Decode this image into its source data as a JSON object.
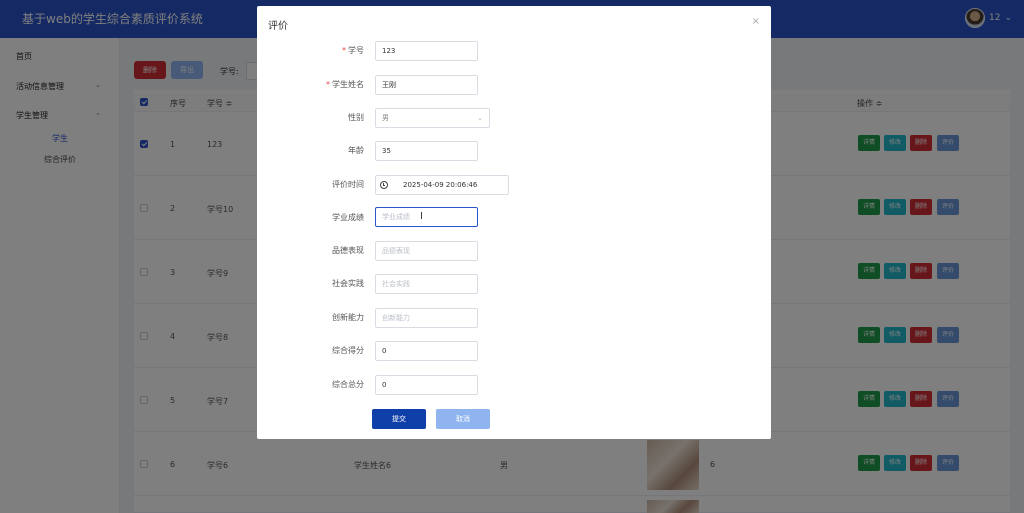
{
  "app": {
    "title": "基于web的学生综合素质评价系统"
  },
  "user": {
    "name": "12",
    "chevron": "⌄"
  },
  "sidebar": {
    "home": "首页",
    "activity": "活动信息管理",
    "student_mgmt": "学生管理",
    "student": "学生",
    "evaluation": "综合评价",
    "arrow_down": "⌄",
    "arrow_up": "⌃"
  },
  "toolbar": {
    "delete_label": "删除",
    "export_label": "导出",
    "student_no_label": "学号:"
  },
  "table": {
    "headers": {
      "index": "序号",
      "student_no": "学号 ≑",
      "actions": "操作 ≑"
    },
    "rows": [
      {
        "index": "1",
        "student_no": "123",
        "name": "",
        "gender": "",
        "extra": "",
        "checked": true
      },
      {
        "index": "2",
        "student_no": "学号10",
        "name": "",
        "gender": "",
        "extra": "",
        "checked": false
      },
      {
        "index": "3",
        "student_no": "学号9",
        "name": "",
        "gender": "",
        "extra": "",
        "checked": false
      },
      {
        "index": "4",
        "student_no": "学号8",
        "name": "",
        "gender": "",
        "extra": "",
        "checked": false
      },
      {
        "index": "5",
        "student_no": "学号7",
        "name": "",
        "gender": "",
        "extra": "",
        "checked": false
      },
      {
        "index": "6",
        "student_no": "学号6",
        "name": "学生姓名6",
        "gender": "男",
        "extra": "6",
        "checked": false
      }
    ],
    "action_labels": {
      "detail": "详情",
      "edit": "修改",
      "delete": "删除",
      "evaluate": "评价"
    }
  },
  "dialog": {
    "title": "评价",
    "close": "×",
    "fields": {
      "student_no": {
        "label": "学号",
        "value": "123"
      },
      "student_name": {
        "label": "学生姓名",
        "value": "王刚"
      },
      "gender": {
        "label": "性别",
        "value": "男"
      },
      "age": {
        "label": "年龄",
        "value": "35"
      },
      "eval_time": {
        "label": "评价时间",
        "value": "2025-04-09 20:06:46"
      },
      "academic": {
        "label": "学业成绩",
        "placeholder": "学业成绩"
      },
      "morality": {
        "label": "品德表现",
        "placeholder": "品德表现"
      },
      "social": {
        "label": "社会实践",
        "placeholder": "社会实践"
      },
      "innovation": {
        "label": "创新能力",
        "placeholder": "创新能力"
      },
      "composite_score": {
        "label": "综合得分",
        "value": "0"
      },
      "composite_total": {
        "label": "综合总分",
        "value": "0"
      }
    },
    "submit_label": "提交",
    "cancel_label": "取消",
    "required_mark": "*",
    "cursor": "I"
  },
  "colors": {
    "header": "#2a55c8",
    "primary": "#0f3fa8",
    "detail": "#1f9a4a",
    "edit": "#23b7c9",
    "delete": "#cf2f35",
    "evaluate": "#6b97d8"
  }
}
